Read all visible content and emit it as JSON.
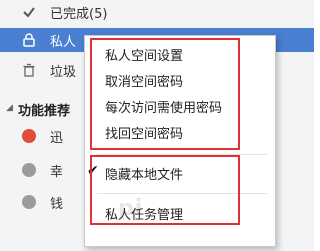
{
  "sidebar": {
    "completed_label": "已完成(5)",
    "private_label": "私人",
    "trash_label": "垃圾",
    "section_title": "功能推荐",
    "rec_items": [
      {
        "label": "迅",
        "color": "#e24b3b"
      },
      {
        "label": "幸",
        "color": "#9b9b9b"
      },
      {
        "label": "钱",
        "color": "#9b9b9b"
      }
    ]
  },
  "context_menu": {
    "items": [
      {
        "label": "私人空间设置",
        "checked": false
      },
      {
        "label": "取消空间密码",
        "checked": false
      },
      {
        "label": "每次访问需使用密码",
        "checked": false
      },
      {
        "label": "找回空间密码",
        "checked": false
      },
      {
        "label": "隐藏本地文件",
        "checked": true
      },
      {
        "label": "私人任务管理",
        "checked": false
      }
    ]
  },
  "watermark": "pi"
}
